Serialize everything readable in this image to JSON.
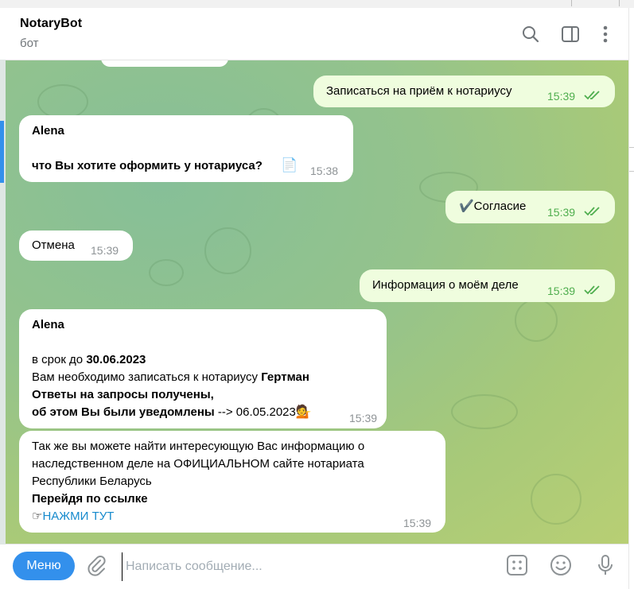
{
  "header": {
    "title": "NotaryBot",
    "subtitle": "бот"
  },
  "messages": {
    "m1": {
      "text": "Записаться на приём к нотариусу",
      "time": "15:39"
    },
    "m2": {
      "sender": "Alena",
      "text": "что Вы хотите оформить у нотариуса?",
      "emoji": "📄",
      "time": "15:38"
    },
    "m3": {
      "text": "✔️Согласие",
      "time": "15:39"
    },
    "m4": {
      "text": "Отмена",
      "time": "15:39"
    },
    "m5": {
      "text": "Информация о моём деле",
      "time": "15:39"
    },
    "m6": {
      "sender": "Alena",
      "l1_prefix": "в срок до ",
      "l1_date": "30.06.2023",
      "l2_prefix": "Вам необходимо записаться к нотариусу ",
      "l2_name": "Гертман",
      "l3": "Ответы на запросы получены,",
      "l4_bold": "об этом Вы были уведомлены",
      "l4_rest": " --> 06.05.2023",
      "emoji": "💁",
      "time": "15:39"
    },
    "m7": {
      "l1": "Так же вы можете найти интересующую Вас информацию о",
      "l2": "наследственном деле на ОФИЦИАЛЬНОМ сайте нотариата",
      "l3": "Республики Беларусь",
      "l4": "Перейдя по ссылке",
      "link_prefix": "☞",
      "link_text": "НАЖМИ ТУТ",
      "time": "15:39"
    }
  },
  "composer": {
    "menu_label": "Меню",
    "placeholder": "Написать сообщение..."
  },
  "colors": {
    "accent": "#3390ec",
    "outgoing_bubble": "#effdde",
    "time_out": "#4fae4e",
    "link": "#168acd"
  },
  "icons": [
    "search-icon",
    "sidebar-toggle-icon",
    "more-vertical-icon",
    "paperclip-icon",
    "bot-commands-icon",
    "emoji-icon",
    "microphone-icon",
    "double-check-icon"
  ]
}
